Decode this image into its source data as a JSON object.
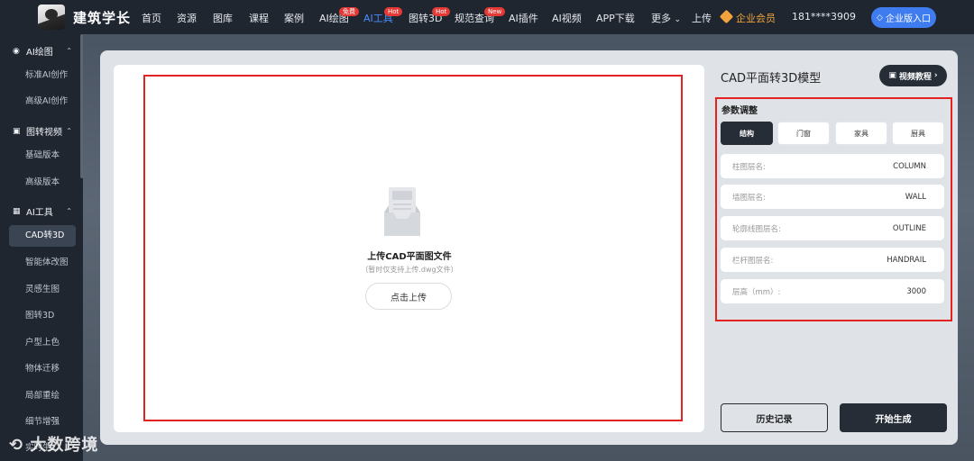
{
  "brand": {
    "name": "建筑学长"
  },
  "nav": {
    "items": [
      {
        "label": "首页"
      },
      {
        "label": "资源"
      },
      {
        "label": "图库"
      },
      {
        "label": "课程"
      },
      {
        "label": "案例"
      },
      {
        "label": "AI绘图",
        "badge": "免费"
      },
      {
        "label": "AI工具",
        "badge": "Hot",
        "active": true
      },
      {
        "label": "图转3D",
        "badge": "Hot"
      },
      {
        "label": "规范查询",
        "badge": "New"
      },
      {
        "label": "AI插件"
      },
      {
        "label": "AI视频"
      },
      {
        "label": "APP下载"
      },
      {
        "label": "更多"
      },
      {
        "label": "上传"
      }
    ],
    "more_arrow": "⌄",
    "vip_label": "企业会员",
    "phone": "181****3909",
    "enterprise_button": "企业版入口"
  },
  "sidebar": {
    "groups": [
      {
        "label": "AI绘图",
        "items": [
          "标准AI创作",
          "高级AI创作"
        ]
      },
      {
        "label": "图转视频",
        "items": [
          "基础版本",
          "高级版本"
        ]
      },
      {
        "label": "AI工具",
        "items": [
          "CAD转3D",
          "智能体改图",
          "灵感生图",
          "图转3D",
          "户型上色",
          "物体迁移",
          "局部重绘",
          "细节增强",
          "实时生..."
        ]
      }
    ],
    "active_item": "CAD转3D"
  },
  "upload": {
    "title": "上传CAD平面图文件",
    "hint": "（暂时仅支持上传.dwg文件）",
    "button": "点击上传"
  },
  "right_panel": {
    "title": "CAD平面转3D模型",
    "video_button": "视频教程",
    "params_label": "参数调整",
    "tabs": [
      {
        "label": "结构",
        "active": true
      },
      {
        "label": "门窗"
      },
      {
        "label": "家具"
      },
      {
        "label": "厨具"
      }
    ],
    "fields": [
      {
        "label": "柱图层名:",
        "value": "COLUMN"
      },
      {
        "label": "墙图层名:",
        "value": "WALL"
      },
      {
        "label": "轮廓线图层名:",
        "value": "OUTLINE"
      },
      {
        "label": "栏杆图层名:",
        "value": "HANDRAIL"
      },
      {
        "label": "层高（mm）:",
        "value": "3000"
      }
    ],
    "history_button": "历史记录",
    "generate_button": "开始生成"
  },
  "watermark": {
    "text": "大数跨境"
  },
  "colors": {
    "accent": "#4a8cff",
    "dark_button": "#262d37",
    "highlight_frame": "#e32222",
    "vip": "#f0a33a",
    "badge": "#e53935"
  }
}
